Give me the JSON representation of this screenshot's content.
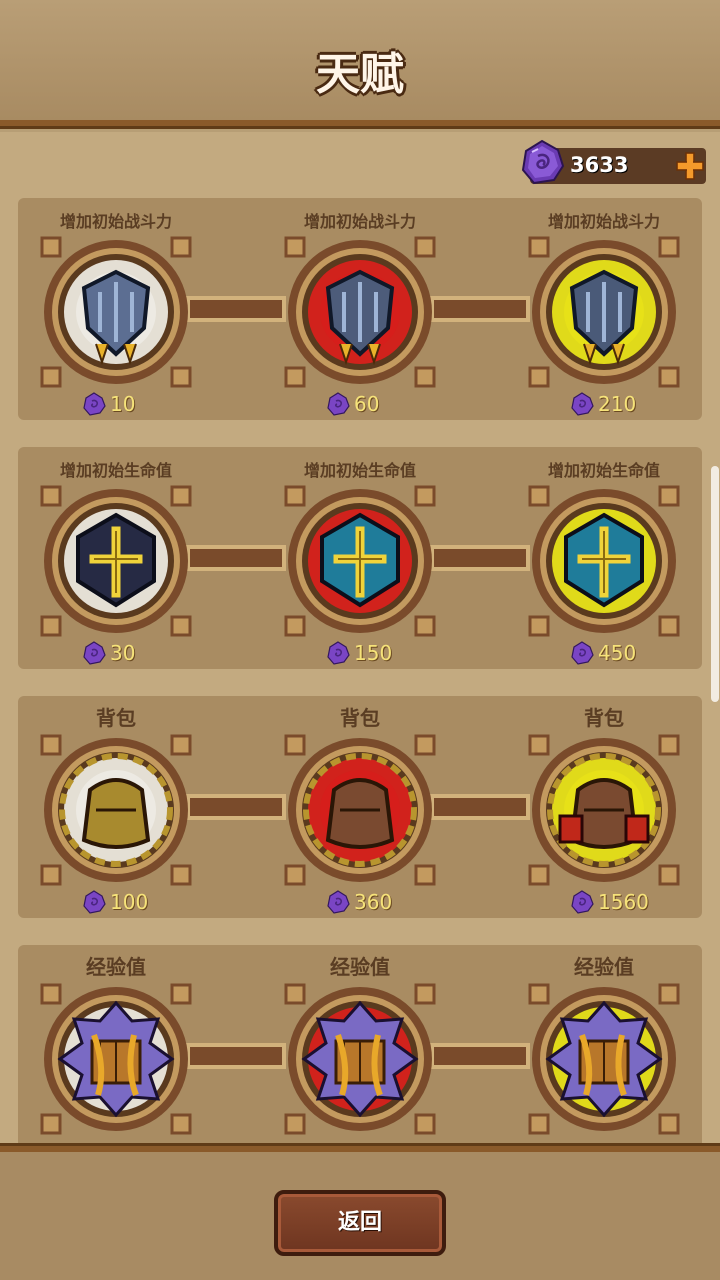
{
  "header": {
    "title": "天赋"
  },
  "currency": {
    "amount": "3633",
    "gem_icon": "purple-gem-icon",
    "add_icon": "plus-icon"
  },
  "rows": [
    {
      "talents": [
        {
          "name": "增加初始战斗力",
          "cost": "10",
          "tier": "white",
          "icon": "shield-icon"
        },
        {
          "name": "增加初始战斗力",
          "cost": "60",
          "tier": "red",
          "icon": "shield-icon"
        },
        {
          "name": "增加初始战斗力",
          "cost": "210",
          "tier": "yellow",
          "icon": "shield-icon"
        }
      ]
    },
    {
      "talents": [
        {
          "name": "增加初始生命值",
          "cost": "30",
          "tier": "white",
          "icon": "cross-emblem-icon"
        },
        {
          "name": "增加初始生命值",
          "cost": "150",
          "tier": "red",
          "icon": "cross-emblem-icon"
        },
        {
          "name": "增加初始生命值",
          "cost": "450",
          "tier": "yellow",
          "icon": "cross-emblem-icon"
        }
      ]
    },
    {
      "talents": [
        {
          "name": "背包",
          "cost": "100",
          "tier": "white",
          "icon": "backpack-icon"
        },
        {
          "name": "背包",
          "cost": "360",
          "tier": "red",
          "icon": "backpack-icon"
        },
        {
          "name": "背包",
          "cost": "1560",
          "tier": "yellow",
          "icon": "backpack-icon"
        }
      ]
    },
    {
      "talents": [
        {
          "name": "经验值",
          "cost": "",
          "tier": "white",
          "icon": "book-icon"
        },
        {
          "name": "经验值",
          "cost": "",
          "tier": "red",
          "icon": "book-icon"
        },
        {
          "name": "经验值",
          "cost": "",
          "tier": "yellow",
          "icon": "book-icon"
        }
      ]
    }
  ],
  "footer": {
    "back_label": "返回"
  },
  "colors": {
    "white_glow": "#ffffff",
    "red_glow": "#e0171a",
    "yellow_glow": "#f4ef18",
    "frame": "#7a4b2b",
    "frame_inner": "#c39a5f"
  }
}
